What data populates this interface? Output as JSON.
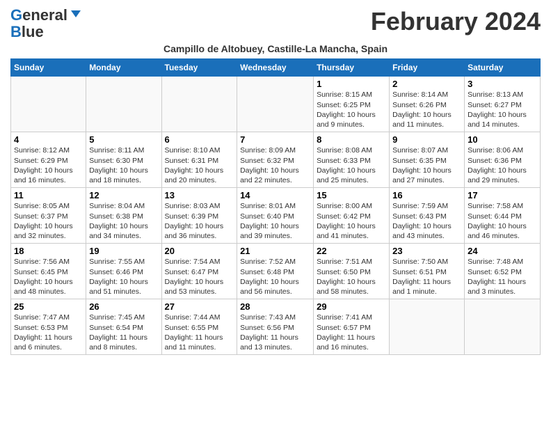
{
  "header": {
    "logo_line1": "General",
    "logo_line2": "Blue",
    "month_title": "February 2024",
    "location": "Campillo de Altobuey, Castille-La Mancha, Spain"
  },
  "days_of_week": [
    "Sunday",
    "Monday",
    "Tuesday",
    "Wednesday",
    "Thursday",
    "Friday",
    "Saturday"
  ],
  "weeks": [
    [
      {
        "day": "",
        "info": ""
      },
      {
        "day": "",
        "info": ""
      },
      {
        "day": "",
        "info": ""
      },
      {
        "day": "",
        "info": ""
      },
      {
        "day": "1",
        "info": "Sunrise: 8:15 AM\nSunset: 6:25 PM\nDaylight: 10 hours\nand 9 minutes."
      },
      {
        "day": "2",
        "info": "Sunrise: 8:14 AM\nSunset: 6:26 PM\nDaylight: 10 hours\nand 11 minutes."
      },
      {
        "day": "3",
        "info": "Sunrise: 8:13 AM\nSunset: 6:27 PM\nDaylight: 10 hours\nand 14 minutes."
      }
    ],
    [
      {
        "day": "4",
        "info": "Sunrise: 8:12 AM\nSunset: 6:29 PM\nDaylight: 10 hours\nand 16 minutes."
      },
      {
        "day": "5",
        "info": "Sunrise: 8:11 AM\nSunset: 6:30 PM\nDaylight: 10 hours\nand 18 minutes."
      },
      {
        "day": "6",
        "info": "Sunrise: 8:10 AM\nSunset: 6:31 PM\nDaylight: 10 hours\nand 20 minutes."
      },
      {
        "day": "7",
        "info": "Sunrise: 8:09 AM\nSunset: 6:32 PM\nDaylight: 10 hours\nand 22 minutes."
      },
      {
        "day": "8",
        "info": "Sunrise: 8:08 AM\nSunset: 6:33 PM\nDaylight: 10 hours\nand 25 minutes."
      },
      {
        "day": "9",
        "info": "Sunrise: 8:07 AM\nSunset: 6:35 PM\nDaylight: 10 hours\nand 27 minutes."
      },
      {
        "day": "10",
        "info": "Sunrise: 8:06 AM\nSunset: 6:36 PM\nDaylight: 10 hours\nand 29 minutes."
      }
    ],
    [
      {
        "day": "11",
        "info": "Sunrise: 8:05 AM\nSunset: 6:37 PM\nDaylight: 10 hours\nand 32 minutes."
      },
      {
        "day": "12",
        "info": "Sunrise: 8:04 AM\nSunset: 6:38 PM\nDaylight: 10 hours\nand 34 minutes."
      },
      {
        "day": "13",
        "info": "Sunrise: 8:03 AM\nSunset: 6:39 PM\nDaylight: 10 hours\nand 36 minutes."
      },
      {
        "day": "14",
        "info": "Sunrise: 8:01 AM\nSunset: 6:40 PM\nDaylight: 10 hours\nand 39 minutes."
      },
      {
        "day": "15",
        "info": "Sunrise: 8:00 AM\nSunset: 6:42 PM\nDaylight: 10 hours\nand 41 minutes."
      },
      {
        "day": "16",
        "info": "Sunrise: 7:59 AM\nSunset: 6:43 PM\nDaylight: 10 hours\nand 43 minutes."
      },
      {
        "day": "17",
        "info": "Sunrise: 7:58 AM\nSunset: 6:44 PM\nDaylight: 10 hours\nand 46 minutes."
      }
    ],
    [
      {
        "day": "18",
        "info": "Sunrise: 7:56 AM\nSunset: 6:45 PM\nDaylight: 10 hours\nand 48 minutes."
      },
      {
        "day": "19",
        "info": "Sunrise: 7:55 AM\nSunset: 6:46 PM\nDaylight: 10 hours\nand 51 minutes."
      },
      {
        "day": "20",
        "info": "Sunrise: 7:54 AM\nSunset: 6:47 PM\nDaylight: 10 hours\nand 53 minutes."
      },
      {
        "day": "21",
        "info": "Sunrise: 7:52 AM\nSunset: 6:48 PM\nDaylight: 10 hours\nand 56 minutes."
      },
      {
        "day": "22",
        "info": "Sunrise: 7:51 AM\nSunset: 6:50 PM\nDaylight: 10 hours\nand 58 minutes."
      },
      {
        "day": "23",
        "info": "Sunrise: 7:50 AM\nSunset: 6:51 PM\nDaylight: 11 hours\nand 1 minute."
      },
      {
        "day": "24",
        "info": "Sunrise: 7:48 AM\nSunset: 6:52 PM\nDaylight: 11 hours\nand 3 minutes."
      }
    ],
    [
      {
        "day": "25",
        "info": "Sunrise: 7:47 AM\nSunset: 6:53 PM\nDaylight: 11 hours\nand 6 minutes."
      },
      {
        "day": "26",
        "info": "Sunrise: 7:45 AM\nSunset: 6:54 PM\nDaylight: 11 hours\nand 8 minutes."
      },
      {
        "day": "27",
        "info": "Sunrise: 7:44 AM\nSunset: 6:55 PM\nDaylight: 11 hours\nand 11 minutes."
      },
      {
        "day": "28",
        "info": "Sunrise: 7:43 AM\nSunset: 6:56 PM\nDaylight: 11 hours\nand 13 minutes."
      },
      {
        "day": "29",
        "info": "Sunrise: 7:41 AM\nSunset: 6:57 PM\nDaylight: 11 hours\nand 16 minutes."
      },
      {
        "day": "",
        "info": ""
      },
      {
        "day": "",
        "info": ""
      }
    ]
  ]
}
